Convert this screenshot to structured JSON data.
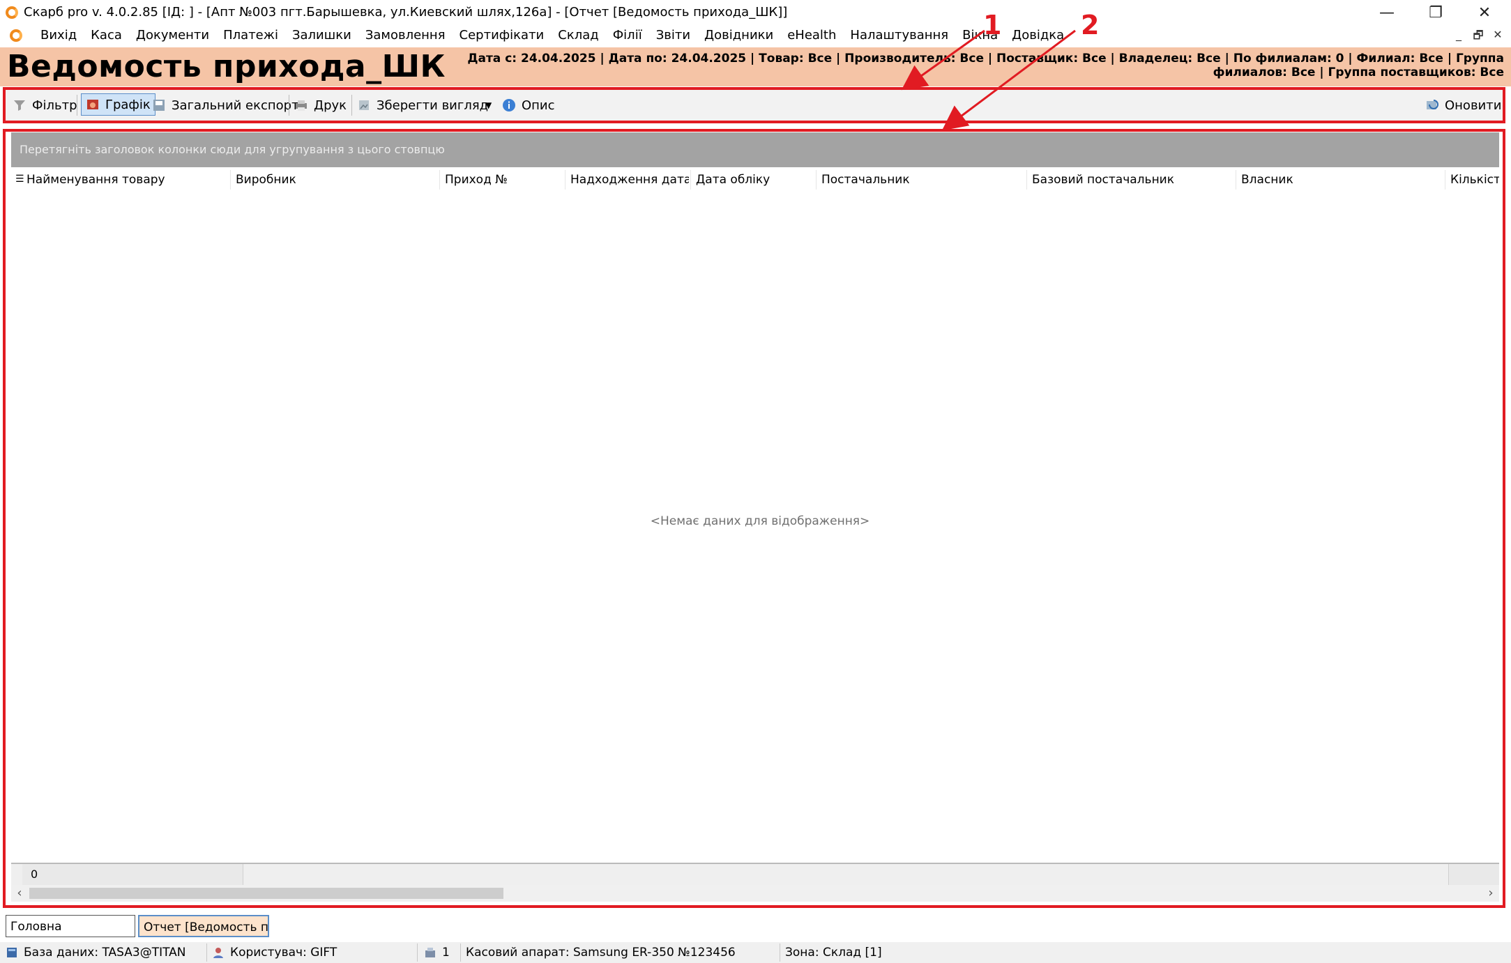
{
  "window": {
    "title": "Скарб pro v. 4.0.2.85 [ІД:       ] - [Апт №003 пгт.Барышевка, ул.Киевский шлях,126а] - [Отчет [Ведомость прихода_ШК]]",
    "minimize": "—",
    "restore": "❐",
    "close": "✕"
  },
  "menu": {
    "items": [
      "Вихід",
      "Каса",
      "Документи",
      "Платежі",
      "Залишки",
      "Замовлення",
      "Сертифікати",
      "Склад",
      "Філії",
      "Звіти",
      "Довідники",
      "eHealth",
      "Налаштування",
      "Вікна",
      "Довідка"
    ],
    "mdi_min": "_",
    "mdi_restore": "🗗",
    "mdi_close": "✕"
  },
  "header": {
    "report_title": "Ведомость прихода_ШК",
    "filters": "Дата с: 24.04.2025 | Дата по: 24.04.2025 | Товар: Все | Производитель: Все | Поставщик: Все | Владелец: Все | По филиалам: 0 | Филиал: Все | Группа филиалов: Все | Группа поставщиков: Все"
  },
  "toolbar": {
    "filter": "Фільтр",
    "chart": "Графік",
    "export": "Загальний експорт",
    "print": "Друк",
    "save_view": "Зберегти вигляд",
    "description": "Опис",
    "refresh": "Оновити"
  },
  "grid": {
    "group_hint": "Перетягніть заголовок колонки сюди для угрупування з цього стовпцю",
    "columns": [
      "Найменування товару",
      "Виробник",
      "Приход №",
      "Надходження дата",
      "Дата обліку",
      "Постачальник",
      "Базовий постачальник",
      "Власник",
      "Кількість"
    ],
    "empty_text": "<Немає даних для відображення>",
    "footer_count": "0"
  },
  "tabs": {
    "main": "Головна",
    "report": "Отчет [Ведомость пр ..."
  },
  "status": {
    "database": "База даних: TASA3@TITAN",
    "user": "Користувач: GIFT",
    "register_num": "1",
    "cash_register": "Касовий апарат: Samsung ER-350 №123456",
    "zone": "Зона: Склад [1]"
  },
  "annotations": {
    "label_1": "1",
    "label_2": "2"
  },
  "colors": {
    "header_bg": "#f5c4a6",
    "annotation_red": "#e11b22",
    "group_panel": "#a3a3a3",
    "active_tab": "#fde3cc"
  }
}
